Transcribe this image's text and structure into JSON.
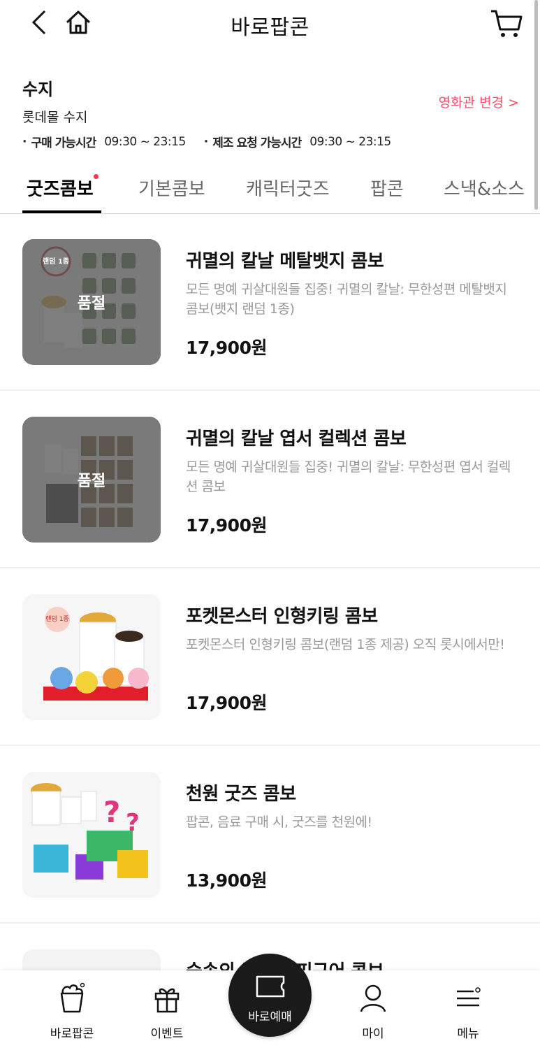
{
  "header": {
    "title": "바로팝콘",
    "back_icon": "chevron-left-icon",
    "home_icon": "home-icon",
    "cart_icon": "cart-icon"
  },
  "theater": {
    "name": "수지",
    "location": "롯데몰 수지",
    "change_label": "영화관 변경 >"
  },
  "hours": {
    "purchase_label": "구매 가능시간",
    "purchase_time": "09:30 ~ 23:15",
    "request_label": "제조 요청 가능시간",
    "request_time": "09:30 ~ 23:15"
  },
  "tabs": [
    {
      "label": "굿즈콤보",
      "active": true
    },
    {
      "label": "기본콤보"
    },
    {
      "label": "캐릭터굿즈"
    },
    {
      "label": "팝콘"
    },
    {
      "label": "스낵&소스"
    }
  ],
  "products": [
    {
      "name": "귀멸의 칼날 메탈뱃지 콤보",
      "desc": "모든 명예 귀살대원들 집중!  귀멸의 칼날: 무한성편 메탈뱃지 콤보(뱃지 랜덤 1종)",
      "price": "17,900원",
      "soldout_label": "품절",
      "badge": "랜덤 1종"
    },
    {
      "name": "귀멸의 칼날 엽서 컬렉션 콤보",
      "desc": "모든 명예 귀살대원들 집중!  귀멸의 칼날: 무한성편 엽서 컬렉션 콤보",
      "price": "17,900원",
      "soldout_label": "품절"
    },
    {
      "name": "포켓몬스터 인형키링 콤보",
      "desc": "포켓몬스터 인형키링 콤보(랜덤 1종 제공)  오직 롯시에서만!",
      "price": "17,900원",
      "badge": "랜덤 1종"
    },
    {
      "name": "천원 굿즈 콤보",
      "desc": "팝콘, 음료 구매 시, 굿즈를 천원에!",
      "price": "13,900원"
    },
    {
      "name": "숲속의 곰돌이 피규어 콤보",
      "desc": "",
      "price": ""
    }
  ],
  "bottom_nav": {
    "popcorn": {
      "label": "바로팝콘",
      "icon": "popcorn-icon"
    },
    "event": {
      "label": "이벤트",
      "icon": "gift-icon"
    },
    "booking": {
      "label": "바로예매",
      "icon": "ticket-icon"
    },
    "my": {
      "label": "마이",
      "icon": "person-icon"
    },
    "menu": {
      "label": "메뉴",
      "icon": "menu-icon"
    }
  },
  "colors": {
    "accent": "#ff4d6a",
    "tab_dot": "#ff3355"
  }
}
